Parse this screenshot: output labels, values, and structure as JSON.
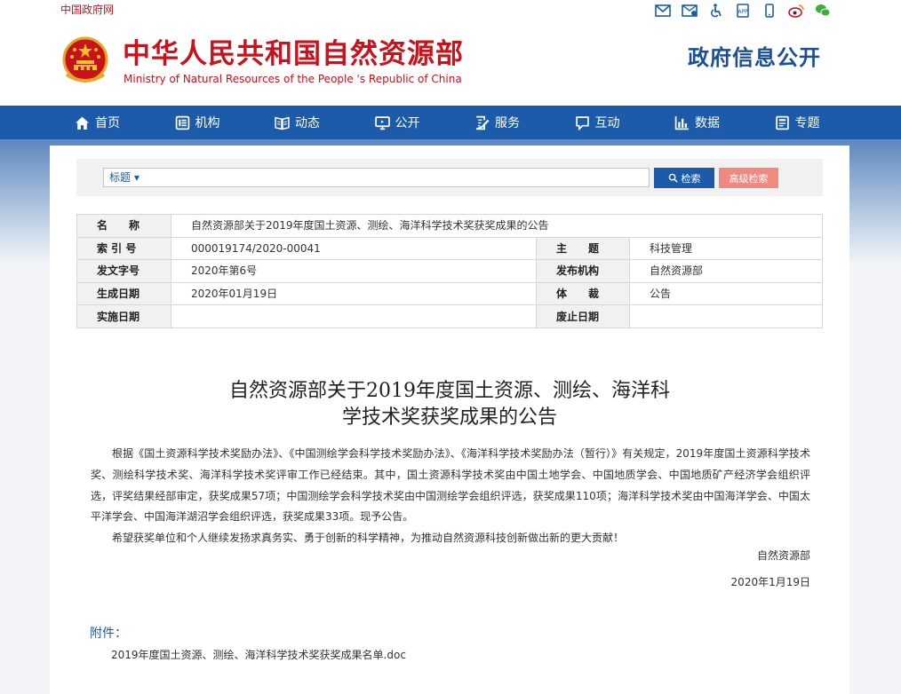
{
  "topbar": {
    "site_link": "中国政府网",
    "icons": [
      "mail-icon",
      "contact-icon",
      "accessibility-icon",
      "app-icon",
      "mobile-icon",
      "weibo-icon",
      "wechat-icon"
    ]
  },
  "header": {
    "cn_title": "中华人民共和国自然资源部",
    "en_title": "Ministry of Natural Resources of the People 's Republic of China",
    "section_title": "政府信息公开"
  },
  "nav": {
    "items": [
      {
        "label": "首页",
        "icon": "home-icon"
      },
      {
        "label": "机构",
        "icon": "org-icon"
      },
      {
        "label": "动态",
        "icon": "book-icon"
      },
      {
        "label": "公开",
        "icon": "monitor-icon"
      },
      {
        "label": "服务",
        "icon": "edit-icon"
      },
      {
        "label": "互动",
        "icon": "chat-icon"
      },
      {
        "label": "数据",
        "icon": "chart-icon"
      },
      {
        "label": "专题",
        "icon": "doc-icon"
      }
    ]
  },
  "search": {
    "type_label": "标题 ▾",
    "search_button": "检索",
    "advanced_button": "高级检索"
  },
  "info": {
    "name_label": "名　　称",
    "name_value": "自然资源部关于2019年度国土资源、测绘、海洋科学技术奖获奖成果的公告",
    "index_label": "索 引 号",
    "index_value": "000019174/2020-00041",
    "subject_label": "主　　题",
    "subject_value": "科技管理",
    "doc_no_label": "发文字号",
    "doc_no_value": "2020年第6号",
    "publisher_label": "发布机构",
    "publisher_value": "自然资源部",
    "created_label": "生成日期",
    "created_value": "2020年01月19日",
    "genre_label": "体　　裁",
    "genre_value": "公告",
    "effective_label": "实施日期",
    "effective_value": "",
    "expiry_label": "废止日期",
    "expiry_value": ""
  },
  "article": {
    "title_line1": "自然资源部关于2019年度国土资源、测绘、海洋科",
    "title_line2": "学技术奖获奖成果的公告",
    "para1": "根据《国土资源科学技术奖励办法》、《中国测绘学会科学技术奖励办法》、《海洋科学技术奖励办法（暂行）》有关规定，2019年度国土资源科学技术奖、测绘科学技术奖、海洋科学技术奖评审工作已经结束。其中，国土资源科学技术奖由中国土地学会、中国地质学会、中国地质矿产经济学会组织评选，评奖结果经部审定，获奖成果57项；中国测绘学会科学技术奖由中国测绘学会组织评选，获奖成果110项；海洋科学技术奖由中国海洋学会、中国太平洋学会、中国海洋湖沼学会组织评选，获奖成果33项。现予公告。",
    "para2": "希望获奖单位和个人继续发扬求真务实、勇于创新的科学精神，为推动自然资源科技创新做出新的更大贡献！",
    "signature": "自然资源部",
    "date": "2020年1月19日",
    "attachment_label": "附件：",
    "attachment_file": "2019年度国土资源、测绘、海洋科学技术奖获奖成果名单.doc"
  },
  "colors": {
    "brand_red": "#c8121c",
    "nav_blue": "#1b5ba9",
    "advanced_btn": "#f08a80"
  }
}
